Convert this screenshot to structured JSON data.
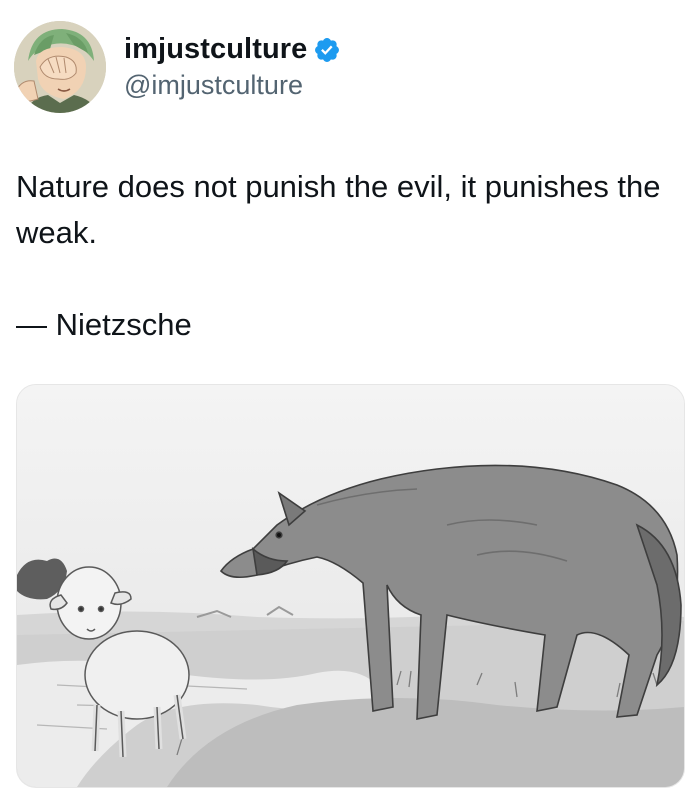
{
  "author": {
    "display_name": "imjustculture",
    "handle": "@imjustculture",
    "verified": true,
    "verified_color": "#1d9bf0",
    "avatar_icon": "anime-character-facepalm-avatar"
  },
  "tweet": {
    "text_line": "Nature does not punish the evil, it punishes the weak.",
    "attribution": "— Nietzsche"
  },
  "media": {
    "icon": "wolf-and-lamb-illustration"
  },
  "colors": {
    "text": "#0f1419",
    "secondary": "#536471"
  }
}
